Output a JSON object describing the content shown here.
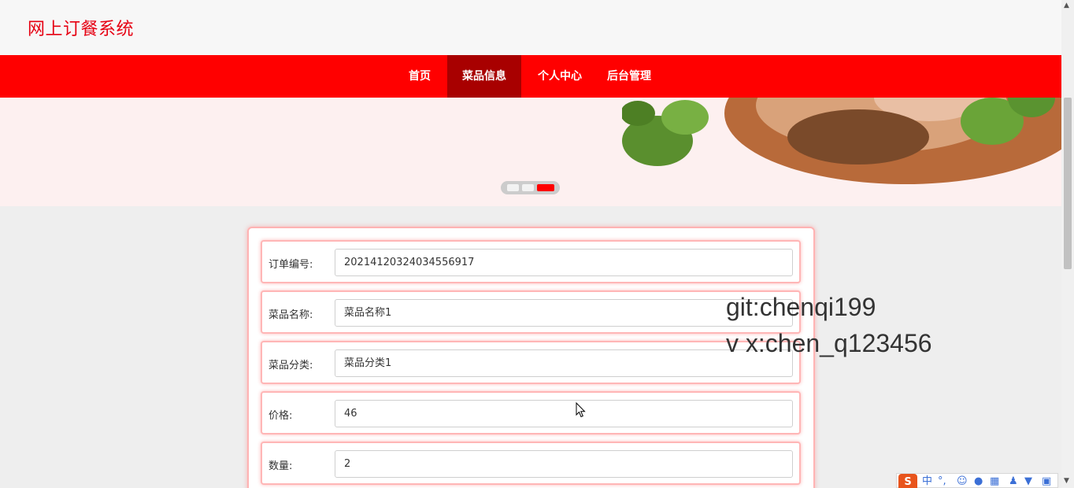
{
  "header": {
    "site_title": "网上订餐系统"
  },
  "nav": {
    "items": [
      {
        "label": "首页"
      },
      {
        "label": "菜品信息"
      },
      {
        "label": "个人中心"
      },
      {
        "label": "后台管理"
      }
    ],
    "active_index": 1
  },
  "banner": {
    "slide_count": 3,
    "active_slide": 3
  },
  "form": {
    "fields": [
      {
        "label": "订单编号:",
        "value": "20214120324034556917"
      },
      {
        "label": "菜品名称:",
        "value": "菜品名称1"
      },
      {
        "label": "菜品分类:",
        "value": "菜品分类1"
      },
      {
        "label": "价格:",
        "value": "46"
      },
      {
        "label": "数量:",
        "value": "2"
      }
    ]
  },
  "watermark": {
    "line1": "git:chenqi199",
    "line2": "v x:chen_q123456"
  },
  "ime": {
    "mode": "中",
    "punct": "°,"
  },
  "colors": {
    "brand_red": "#ff0000",
    "active_nav": "#a80000",
    "title_red": "#e60012"
  }
}
